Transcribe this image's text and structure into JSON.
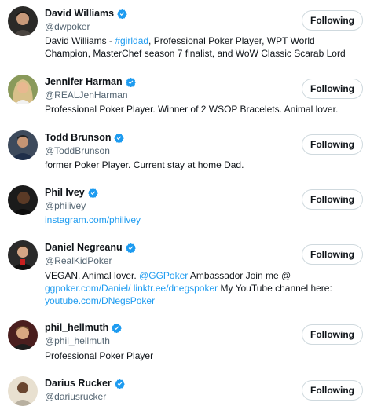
{
  "follow_label": "Following",
  "accent": "#1d9bf0",
  "users": [
    {
      "name": "David Williams",
      "handle": "@dwpoker",
      "verified": true,
      "bio": [
        {
          "t": "David Williams - ",
          "k": "text"
        },
        {
          "t": "#girldad",
          "k": "tag"
        },
        {
          "t": ", Professional Poker Player, WPT World Champion, MasterChef season 7 finalist, and WoW Classic Scarab Lord",
          "k": "text"
        }
      ]
    },
    {
      "name": "Jennifer Harman",
      "handle": "@REALJenHarman",
      "verified": true,
      "bio": [
        {
          "t": "Professional Poker Player. Winner of 2 WSOP Bracelets. Animal lover.",
          "k": "text"
        }
      ]
    },
    {
      "name": "Todd Brunson",
      "handle": "@ToddBrunson",
      "verified": true,
      "bio": [
        {
          "t": "former Poker Player. Current stay at home Dad.",
          "k": "text"
        }
      ]
    },
    {
      "name": "Phil Ivey",
      "handle": "@philivey",
      "verified": true,
      "bio": [
        {
          "t": "instagram.com/philivey",
          "k": "link"
        }
      ]
    },
    {
      "name": "Daniel Negreanu",
      "handle": "@RealKidPoker",
      "verified": true,
      "bio": [
        {
          "t": "VEGAN. Animal lover. ",
          "k": "text"
        },
        {
          "t": "@GGPoker",
          "k": "link"
        },
        {
          "t": " Ambassador Join me @ ",
          "k": "text"
        },
        {
          "t": "ggpoker.com/Daniel/",
          "k": "link"
        },
        {
          "t": " ",
          "k": "text"
        },
        {
          "t": "linktr.ee/dnegspoker",
          "k": "link"
        },
        {
          "t": " My YouTube channel here: ",
          "k": "text"
        },
        {
          "t": "youtube.com/DNegsPoker",
          "k": "link"
        }
      ]
    },
    {
      "name": "phil_hellmuth",
      "handle": "@phil_hellmuth",
      "verified": true,
      "bio": [
        {
          "t": "Professional Poker Player",
          "k": "text"
        }
      ]
    },
    {
      "name": "Darius Rucker",
      "handle": "@dariusrucker",
      "verified": true,
      "bio": []
    }
  ]
}
